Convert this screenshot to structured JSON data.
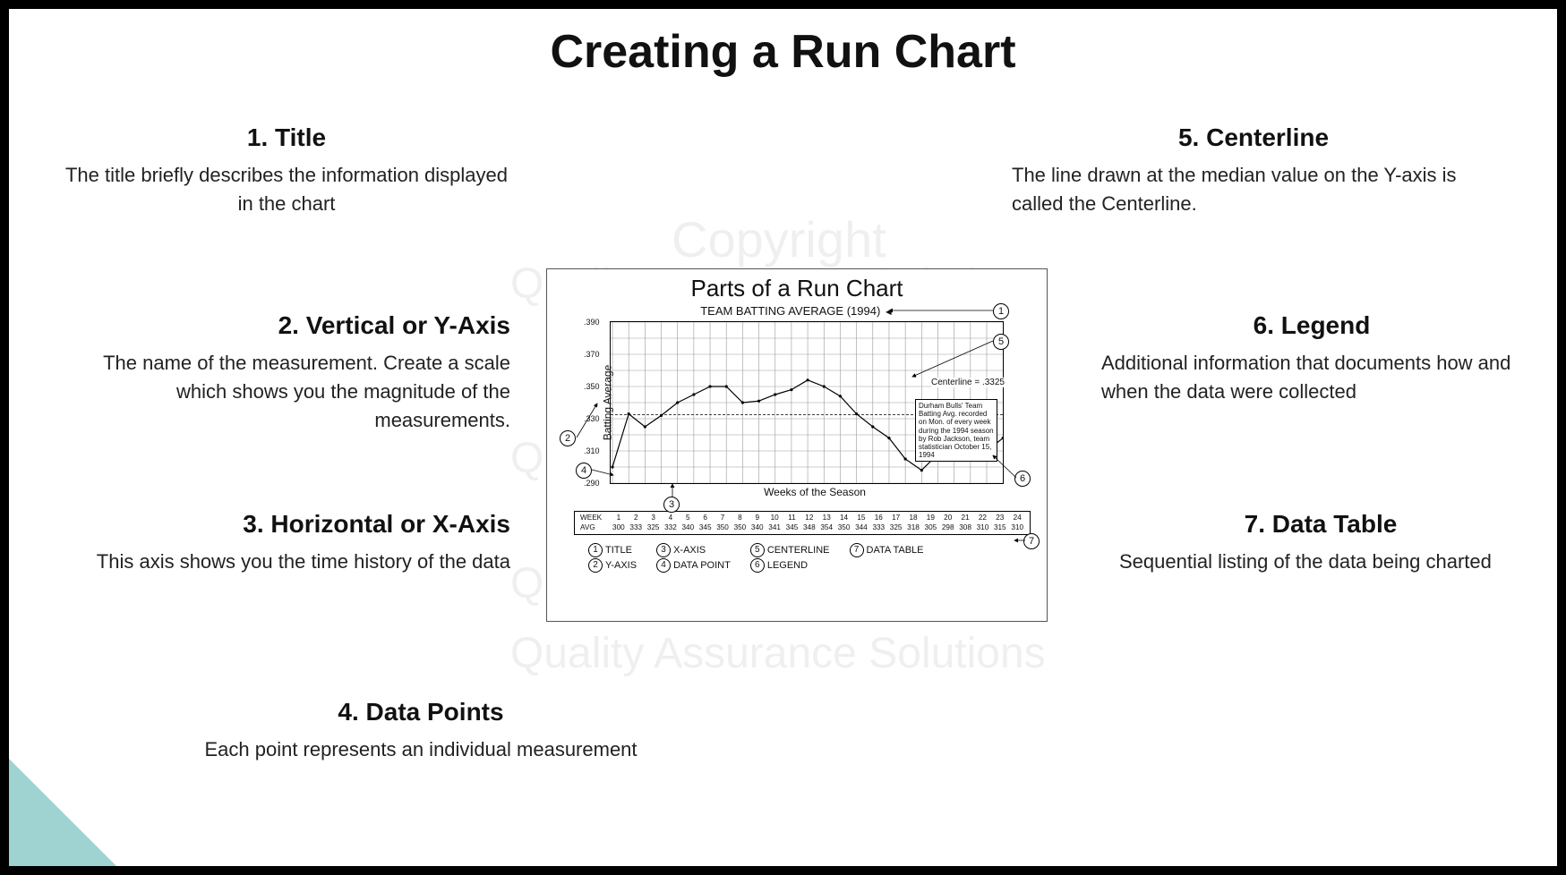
{
  "page": {
    "title": "Creating a Run Chart"
  },
  "watermarks": {
    "line1": "Copyright",
    "line2": "Quality Assurance Solutions"
  },
  "sections": [
    {
      "heading": "1. Title",
      "body": "The title briefly describes the information displayed in the chart"
    },
    {
      "heading": "2. Vertical or Y-Axis",
      "body": "The name of the measurement. Create a scale which shows you the magnitude of the measurements."
    },
    {
      "heading": "3. Horizontal or X-Axis",
      "body": "This axis shows you the time history of the data"
    },
    {
      "heading": "4. Data Points",
      "body": "Each point represents an individual measurement"
    },
    {
      "heading": "5. Centerline",
      "body": "The line drawn at the median value on the Y-axis is called the Centerline."
    },
    {
      "heading": "6. Legend",
      "body": "Additional information that documents how and when the data were collected"
    },
    {
      "heading": "7. Data Table",
      "body": "Sequential listing of the data being charted"
    }
  ],
  "diagram": {
    "title": "Parts of a Run Chart",
    "subtitle": "TEAM BATTING AVERAGE (1994)",
    "ylabel": "Batting Average",
    "xlabel": "Weeks of the Season",
    "centerline_label": "Centerline = .3325",
    "legend_text": "Durham Bulls' Team Batting Avg. recorded on Mon. of every week during the 1994 season by Rob Jackson, team statistician October 15, 1994",
    "data_row_labels": {
      "week": "WEEK",
      "avg": "AVG"
    },
    "key_items": [
      "TITLE",
      "Y-AXIS",
      "X-AXIS",
      "DATA POINT",
      "CENTERLINE",
      "LEGEND",
      "DATA TABLE"
    ]
  },
  "chart_data": {
    "type": "line",
    "title": "TEAM BATTING AVERAGE (1994)",
    "xlabel": "Weeks of the Season",
    "ylabel": "Batting Average",
    "ylim": [
      0.29,
      0.39
    ],
    "centerline": 0.3325,
    "categories": [
      1,
      2,
      3,
      4,
      5,
      6,
      7,
      8,
      9,
      10,
      11,
      12,
      13,
      14,
      15,
      16,
      17,
      18,
      19,
      20,
      21,
      22,
      23,
      24
    ],
    "series": [
      {
        "name": "AVG",
        "values": [
          0.3,
          0.333,
          0.325,
          0.332,
          0.34,
          0.345,
          0.35,
          0.35,
          0.34,
          0.341,
          0.345,
          0.348,
          0.354,
          0.35,
          0.344,
          0.333,
          0.325,
          0.318,
          0.305,
          0.298,
          0.308,
          0.31,
          0.315,
          0.31,
          0.318
        ]
      }
    ]
  }
}
